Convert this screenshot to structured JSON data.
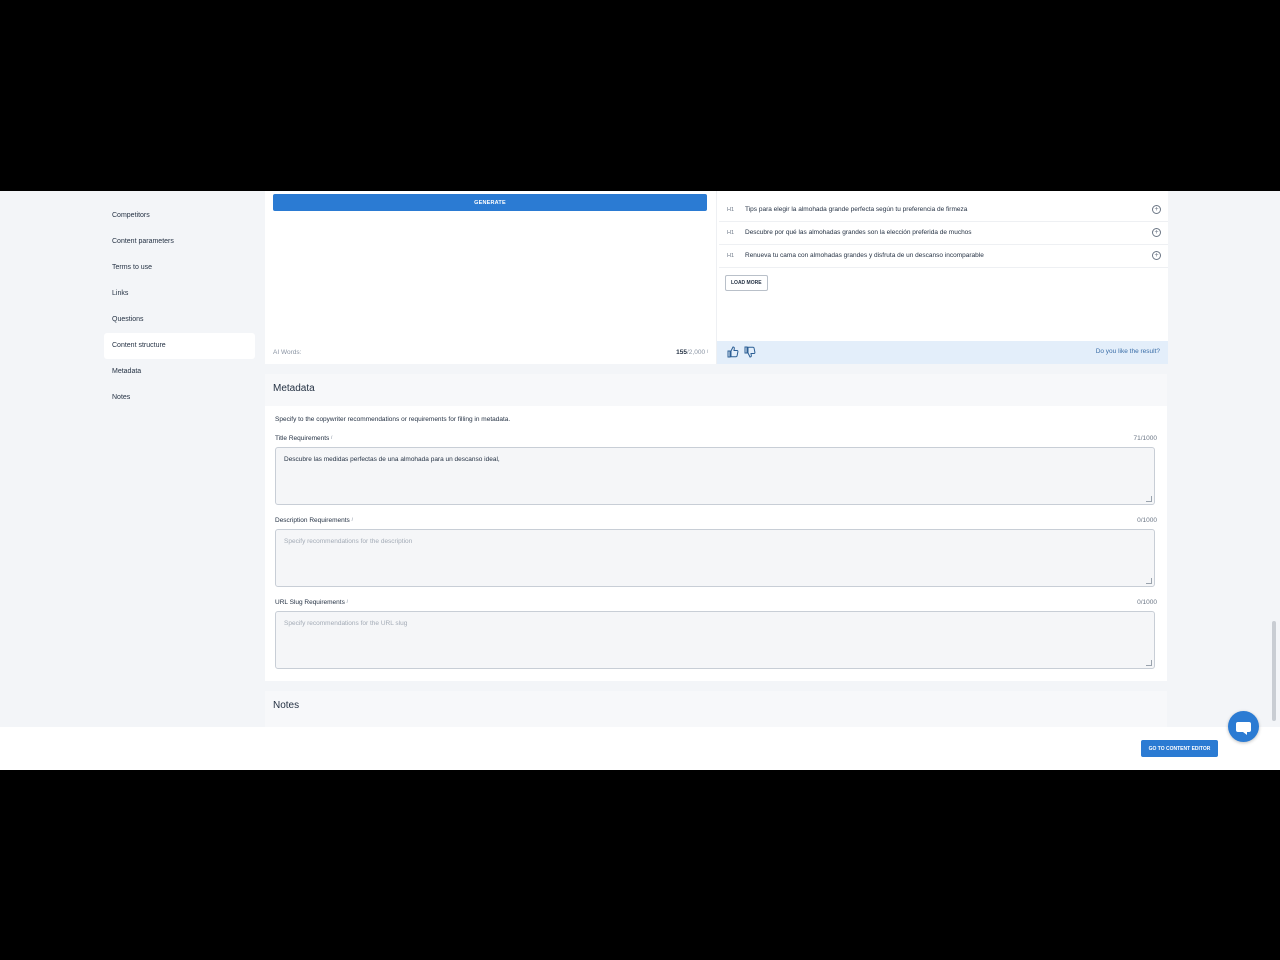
{
  "sidebar": {
    "items": [
      {
        "label": "Competitors"
      },
      {
        "label": "Content parameters"
      },
      {
        "label": "Terms to use"
      },
      {
        "label": "Links"
      },
      {
        "label": "Questions"
      },
      {
        "label": "Content structure",
        "active": true
      },
      {
        "label": "Metadata"
      },
      {
        "label": "Notes"
      }
    ]
  },
  "generator": {
    "button_label": "GENERATE",
    "ai_words_label": "AI Words:",
    "ai_words_used": "155",
    "ai_words_limit": "/2,000"
  },
  "headings": {
    "items": [
      {
        "tag": "H1",
        "text": "Tips para elegir la almohada grande perfecta según tu preferencia de firmeza"
      },
      {
        "tag": "H1",
        "text": "Descubre por qué las almohadas grandes son la elección preferida de muchos"
      },
      {
        "tag": "H1",
        "text": "Renueva tu cama con almohadas grandes y disfruta de un descanso incomparable"
      }
    ],
    "load_more_label": "LOAD MORE",
    "feedback_question": "Do you like the result?"
  },
  "metadata": {
    "title": "Metadata",
    "hint": "Specify to the copywriter recommendations or requirements for filling in metadata.",
    "title_req": {
      "label": "Title Requirements",
      "count": "71/1000",
      "value": "Descubre las medidas perfectas de una almohada para un descanso ideal,"
    },
    "description_req": {
      "label": "Description Requirements",
      "count": "0/1000",
      "placeholder": "Specify recommendations for the description"
    },
    "slug_req": {
      "label": "URL Slug Requirements",
      "count": "0/1000",
      "placeholder": "Specify recommendations for the URL slug"
    }
  },
  "notes": {
    "title": "Notes"
  },
  "footer": {
    "go_button_label": "GO TO CONTENT EDITOR"
  },
  "colors": {
    "accent": "#2b7bd3",
    "background": "#f3f5f8"
  }
}
